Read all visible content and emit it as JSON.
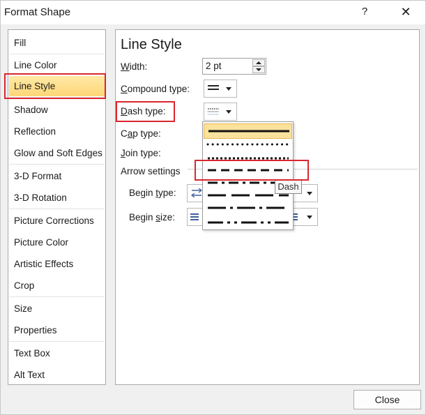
{
  "window": {
    "title": "Format Shape",
    "help": "?",
    "close_glyph": "✕"
  },
  "nav": {
    "items": [
      "Fill",
      "Line Color",
      "Line Style",
      "Shadow",
      "Reflection",
      "Glow and Soft Edges",
      "3-D Format",
      "3-D Rotation",
      "Picture Corrections",
      "Picture Color",
      "Artistic Effects",
      "Crop",
      "Size",
      "Properties",
      "Text Box",
      "Alt Text"
    ],
    "selected": "Line Style"
  },
  "panel": {
    "title": "Line Style",
    "width_label_u": "W",
    "width_label_rest": "idth:",
    "width_value": "2 pt",
    "compound_label_u": "C",
    "compound_label_rest": "ompound type:",
    "dash_label_u": "D",
    "dash_label_rest": "ash type:",
    "cap_label_pre": "C",
    "cap_label_u": "a",
    "cap_label_rest": "p type:",
    "join_label_u": "J",
    "join_label_rest": "oin type:",
    "arrow_settings": "Arrow settings",
    "begin_type_pre": "Begin ",
    "begin_type_u": "t",
    "begin_type_rest": "ype:",
    "begin_size_pre": "Begin ",
    "begin_size_u": "s",
    "begin_size_rest": "ize:"
  },
  "dash_menu": {
    "options": [
      "Solid",
      "Round Dot",
      "Square Dot",
      "Dash",
      "Dash Dot",
      "Long Dash",
      "Long Dash Dot",
      "Long Dash Dot Dot"
    ],
    "tooltip": "Dash"
  },
  "footer": {
    "close_label": "Close"
  },
  "colors": {
    "selected_bg": "#fdd677",
    "highlight_border": "#d9262e"
  }
}
